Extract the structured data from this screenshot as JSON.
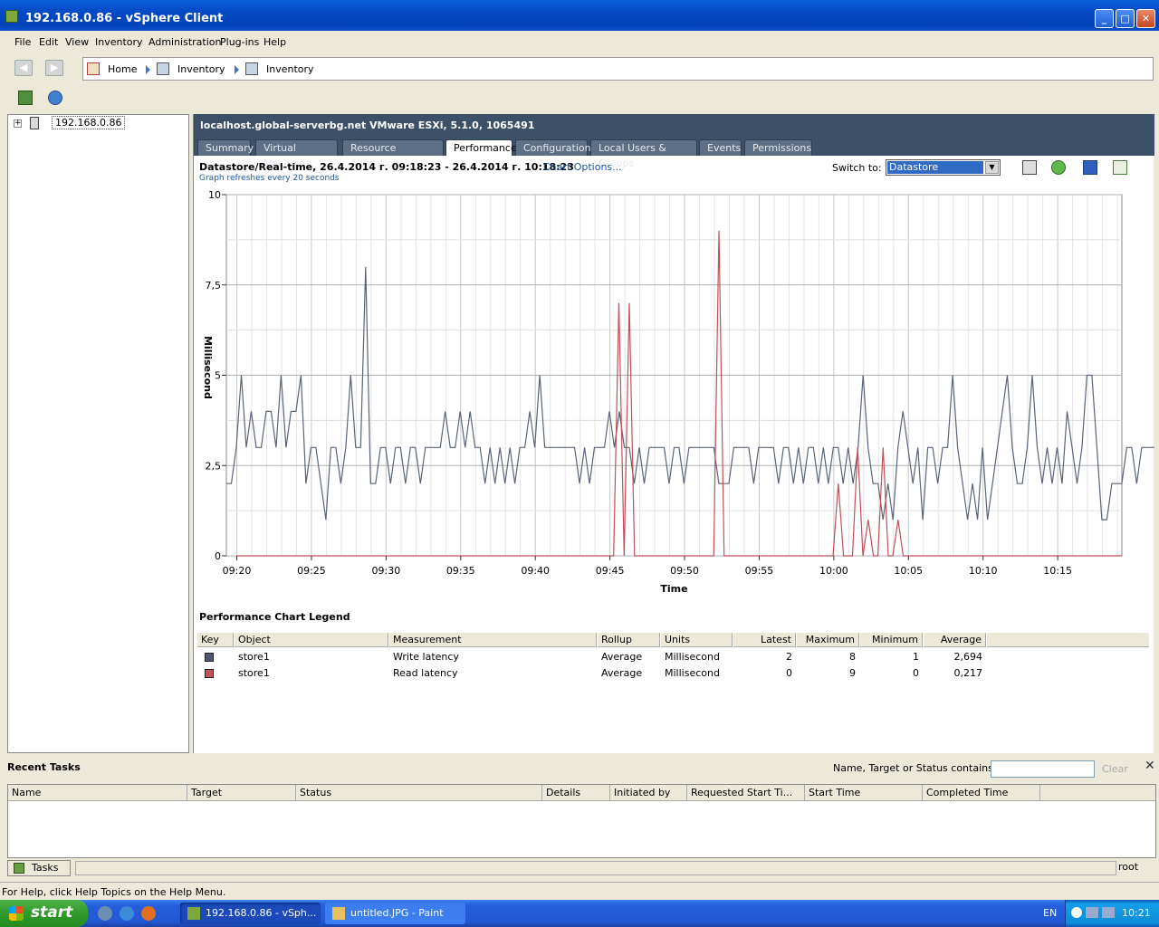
{
  "window": {
    "title": "192.168.0.86 - vSphere Client"
  },
  "menu": [
    "File",
    "Edit",
    "View",
    "Inventory",
    "Administration",
    "Plug-ins",
    "Help"
  ],
  "breadcrumb": {
    "home": "Home",
    "item1": "Inventory",
    "item2": "Inventory"
  },
  "tree": {
    "host": "192.168.0.86",
    "expander": "+"
  },
  "host_header": {
    "title": "localhost.global-serverbg.net VMware ESXi, 5.1.0, 1065491"
  },
  "tabs": [
    "Summary",
    "Virtual Machines",
    "Resource Allocation",
    "Performance",
    "Configuration",
    "Local Users & Groups",
    "Events",
    "Permissions"
  ],
  "active_tab": "Performance",
  "performance": {
    "heading": "Datastore/Real-time, 26.4.2014 г. 09:18:23 - 26.4.2014 г. 10:18:23",
    "chart_options": "Chart Options...",
    "refresh_note": "Graph refreshes every 20 seconds",
    "switch_to_label": "Switch to:",
    "switch_to_value": "Datastore"
  },
  "chart_data": {
    "type": "line",
    "xlabel": "Time",
    "ylabel": "Millisecond",
    "ylim": [
      0,
      10
    ],
    "yticks": [
      "0",
      "2,5",
      "5",
      "7,5",
      "10"
    ],
    "xticks": [
      "09:20",
      "09:25",
      "09:30",
      "09:35",
      "09:40",
      "09:45",
      "09:50",
      "09:55",
      "10:00",
      "10:05",
      "10:10",
      "10:15"
    ],
    "x_start_minute": 19.3,
    "x_step_minutes": 0.3333,
    "grid": true,
    "series": [
      {
        "name": "Write latency",
        "color": "#5a6477",
        "values": [
          2,
          2,
          3,
          5,
          3,
          4,
          3,
          3,
          4,
          4,
          3,
          5,
          3,
          4,
          4,
          5,
          2,
          3,
          3,
          2,
          1,
          3,
          3,
          2,
          3,
          5,
          3,
          3,
          8,
          2,
          2,
          3,
          3,
          2,
          3,
          3,
          2,
          3,
          3,
          2,
          3,
          3,
          3,
          3,
          4,
          3,
          3,
          4,
          3,
          4,
          3,
          3,
          2,
          3,
          2,
          3,
          2,
          3,
          2,
          3,
          3,
          4,
          3,
          5,
          3,
          3,
          3,
          3,
          3,
          3,
          3,
          2,
          3,
          2,
          3,
          3,
          3,
          4,
          3,
          4,
          3,
          3,
          2,
          3,
          2,
          3,
          3,
          3,
          3,
          2,
          3,
          3,
          2,
          3,
          3,
          3,
          3,
          3,
          3,
          2,
          2,
          2,
          3,
          3,
          3,
          3,
          2,
          3,
          3,
          3,
          3,
          2,
          3,
          3,
          2,
          3,
          2,
          3,
          3,
          2,
          3,
          2,
          3,
          3,
          2,
          3,
          2,
          3,
          5,
          3,
          2,
          2,
          1,
          2,
          1,
          3,
          4,
          3,
          2,
          3,
          1,
          3,
          3,
          2,
          3,
          3,
          5,
          3,
          2,
          1,
          2,
          1,
          3,
          1,
          2,
          3,
          4,
          5,
          3,
          2,
          2,
          3,
          5,
          3,
          2,
          3,
          2,
          3,
          2,
          4,
          3,
          2,
          3,
          5,
          5,
          3,
          1,
          1,
          2,
          2,
          2,
          3,
          3,
          2,
          3,
          3,
          3,
          3,
          3,
          2,
          2
        ]
      },
      {
        "name": "Read latency",
        "color": "#c0505a",
        "values": [
          0,
          0,
          0,
          0,
          0,
          0,
          0,
          0,
          0,
          0,
          0,
          0,
          0,
          0,
          0,
          0,
          0,
          0,
          0,
          0,
          0,
          0,
          0,
          0,
          0,
          0,
          0,
          0,
          0,
          0,
          0,
          0,
          0,
          0,
          0,
          0,
          0,
          0,
          0,
          0,
          0,
          0,
          0,
          0,
          0,
          0,
          0,
          0,
          0,
          0,
          0,
          0,
          0,
          0,
          0,
          0,
          0,
          0,
          0,
          0,
          0,
          0,
          0,
          0,
          0,
          0,
          0,
          0,
          0,
          0,
          0,
          0,
          0,
          0,
          0,
          0,
          0,
          0,
          0,
          0,
          0,
          0,
          0,
          0,
          0,
          0,
          0,
          0,
          0,
          0,
          0,
          0,
          0,
          0,
          0,
          0,
          0,
          0,
          0,
          0,
          0,
          0,
          0,
          0,
          0,
          0,
          0,
          0,
          0,
          0,
          0,
          0,
          0,
          0,
          0,
          0,
          0,
          0,
          0,
          0,
          0,
          0,
          0,
          0,
          0,
          0,
          0,
          0,
          0,
          0,
          0,
          0,
          0,
          0,
          0,
          0,
          0,
          0,
          0,
          0,
          0,
          0,
          0,
          0,
          0,
          0,
          0,
          0,
          0,
          0,
          0,
          0,
          0,
          0,
          0,
          0,
          0,
          0,
          0,
          0,
          0,
          0,
          0,
          0,
          0,
          0,
          0,
          0,
          0,
          0,
          0,
          0,
          0,
          0,
          0,
          0,
          0,
          0,
          0,
          0,
          0,
          0,
          0,
          0,
          0,
          0,
          0,
          0,
          0,
          0,
          0
        ],
        "spikes": [
          [
            45.6,
            7
          ],
          [
            46.3,
            7
          ],
          [
            52.3,
            9
          ],
          [
            60.3,
            2
          ],
          [
            61.6,
            3
          ],
          [
            62.3,
            1
          ],
          [
            63.3,
            3
          ],
          [
            64.3,
            1
          ]
        ]
      }
    ]
  },
  "legend": {
    "title": "Performance Chart Legend",
    "headers": [
      "Key",
      "Object",
      "Measurement",
      "Rollup",
      "Units",
      "Latest",
      "Maximum",
      "Minimum",
      "Average"
    ],
    "rows": [
      {
        "key_color": "#4f5870",
        "object": "store1",
        "measurement": "Write latency",
        "rollup": "Average",
        "units": "Millisecond",
        "latest": "2",
        "maximum": "8",
        "minimum": "1",
        "average": "2,694"
      },
      {
        "key_color": "#c9505a",
        "object": "store1",
        "measurement": "Read latency",
        "rollup": "Average",
        "units": "Millisecond",
        "latest": "0",
        "maximum": "9",
        "minimum": "0",
        "average": "0,217"
      }
    ]
  },
  "recent_tasks": {
    "title": "Recent Tasks",
    "filter_label": "Name, Target or Status contains: ▾",
    "filter_value": "",
    "clear_label": "Clear",
    "headers": [
      "Name",
      "Target",
      "Status",
      "Details",
      "Initiated by",
      "Requested Start Ti...",
      "Start Time",
      "Completed Time"
    ],
    "tab_label": "Tasks",
    "user": "root"
  },
  "statusbar": "For Help, click Help Topics on the Help Menu.",
  "taskbar": {
    "start": "start",
    "buttons": [
      "192.168.0.86 - vSph...",
      "untitled.JPG - Paint"
    ],
    "lang": "EN",
    "clock": "10:21"
  }
}
